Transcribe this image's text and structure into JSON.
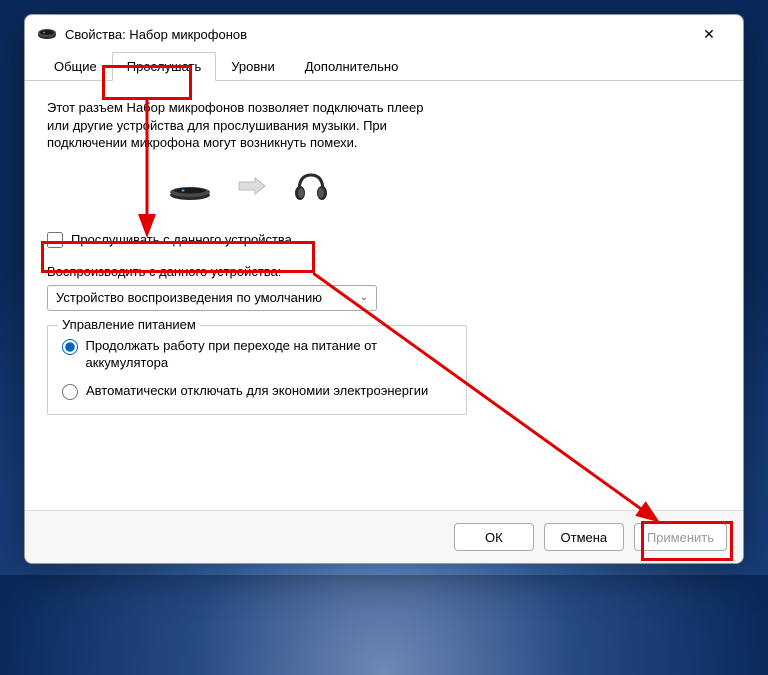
{
  "window": {
    "title": "Свойства: Набор микрофонов"
  },
  "tabs": {
    "general": "Общие",
    "listen": "Прослушать",
    "levels": "Уровни",
    "advanced": "Дополнительно"
  },
  "content": {
    "description": "Этот разъем Набор микрофонов позволяет подключать плеер или другие устройства для прослушивания музыки. При подключении микрофона могут возникнуть помехи.",
    "listen_checkbox": "Прослушивать с данного устройства",
    "play_through_label": "Воспроизводить с данного устройства:",
    "dropdown_value": "Устройство воспроизведения по умолчанию",
    "power_legend": "Управление питанием",
    "radio_continue": "Продолжать работу при переходе на питание от аккумулятора",
    "radio_auto_off": "Автоматически отключать для экономии электроэнергии"
  },
  "buttons": {
    "ok": "ОК",
    "cancel": "Отмена",
    "apply": "Применить"
  },
  "icons": {
    "close": "✕",
    "caret": "⌄"
  }
}
